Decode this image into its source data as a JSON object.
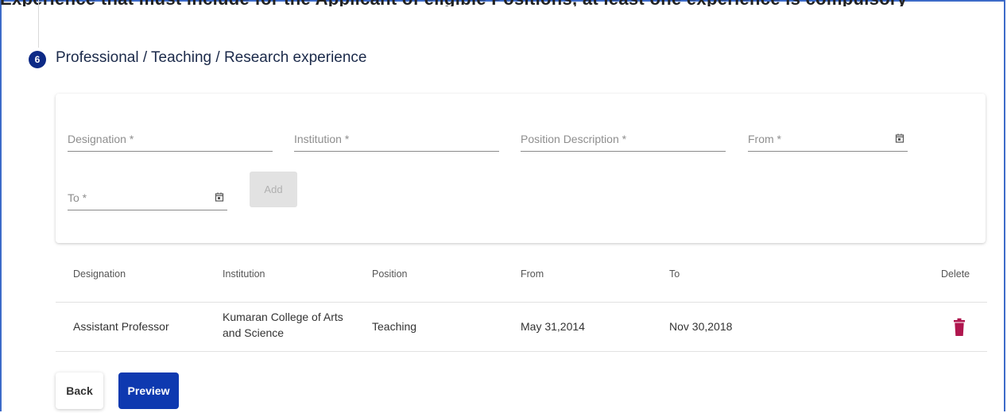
{
  "header_partial_text": "Experience that must include for the Applicant of eligible Positions, at least one experience is compulsory",
  "section": {
    "step_number": "6",
    "title": "Professional / Teaching / Research experience"
  },
  "form": {
    "designation_placeholder": "Designation *",
    "institution_placeholder": "Institution *",
    "position_description_placeholder": "Position Description *",
    "from_placeholder": "From *",
    "to_placeholder": "To *",
    "add_label": "Add"
  },
  "table": {
    "headers": {
      "designation": "Designation",
      "institution": "Institution",
      "position": "Position",
      "from": "From",
      "to": "To",
      "delete": "Delete"
    },
    "rows": [
      {
        "designation": "Assistant Professor",
        "institution": "Kumaran College of Arts and Science",
        "position": "Teaching",
        "from": "May 31,2014",
        "to": "Nov 30,2018"
      }
    ]
  },
  "buttons": {
    "back": "Back",
    "preview": "Preview"
  },
  "colors": {
    "primary": "#0e39b0",
    "step": "#0d2a86",
    "delete": "#b0164e",
    "frame": "#3d6bc9"
  },
  "icons": {
    "calendar": "calendar-icon",
    "delete": "trash-icon"
  }
}
